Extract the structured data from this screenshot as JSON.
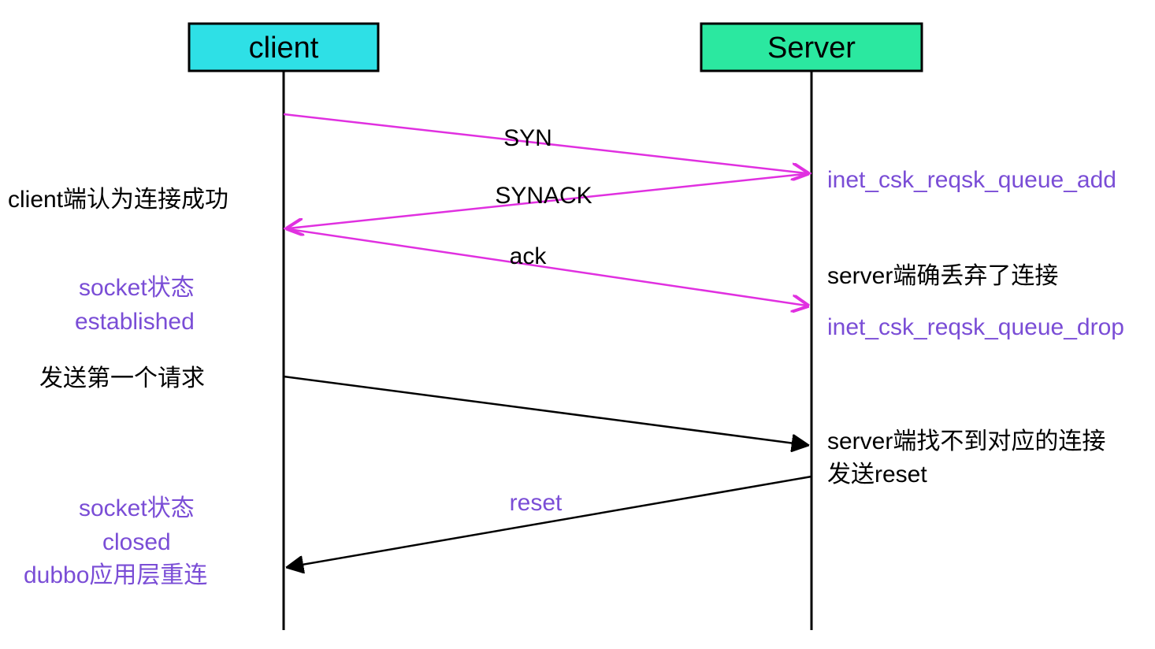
{
  "actors": {
    "client": {
      "label": "client",
      "fill": "#2ee0e6"
    },
    "server": {
      "label": "Server",
      "fill": "#2be8a0"
    }
  },
  "messages": {
    "syn": "SYN",
    "synack": "SYNACK",
    "ack": "ack",
    "reset": "reset"
  },
  "notes": {
    "client_connect_ok": "client端认为连接成功",
    "socket_established_1": "socket状态",
    "socket_established_2": "established",
    "send_first_request": "发送第一个请求",
    "socket_closed_1": "socket状态",
    "socket_closed_2": "closed",
    "socket_closed_3": "dubbo应用层重连",
    "server_queue_add": "inet_csk_reqsk_queue_add",
    "server_drop_conn": "server端确丢弃了连接",
    "server_queue_drop": "inet_csk_reqsk_queue_drop",
    "server_not_found_1": "server端找不到对应的连接",
    "server_not_found_2": "发送reset"
  },
  "chart_data": {
    "type": "sequence_diagram",
    "actors": [
      "client",
      "Server"
    ],
    "events": [
      {
        "from": "client",
        "to": "Server",
        "label": "SYN",
        "color": "magenta"
      },
      {
        "at": "Server",
        "note": "inet_csk_reqsk_queue_add",
        "color": "purple"
      },
      {
        "from": "Server",
        "to": "client",
        "label": "SYNACK",
        "color": "magenta"
      },
      {
        "at": "client",
        "note": "client端认为连接成功",
        "color": "black"
      },
      {
        "from": "client",
        "to": "Server",
        "label": "ack",
        "color": "magenta"
      },
      {
        "at": "client",
        "note": "socket状态 established",
        "color": "purple"
      },
      {
        "at": "Server",
        "note": "server端确丢弃了连接",
        "color": "black"
      },
      {
        "at": "Server",
        "note": "inet_csk_reqsk_queue_drop",
        "color": "purple"
      },
      {
        "at": "client",
        "note": "发送第一个请求",
        "color": "black"
      },
      {
        "from": "client",
        "to": "Server",
        "label": "",
        "color": "black"
      },
      {
        "at": "Server",
        "note": "server端找不到对应的连接 发送reset",
        "color": "black"
      },
      {
        "from": "Server",
        "to": "client",
        "label": "reset",
        "color": "black"
      },
      {
        "at": "client",
        "note": "socket状态 closed dubbo应用层重连",
        "color": "purple"
      }
    ]
  }
}
